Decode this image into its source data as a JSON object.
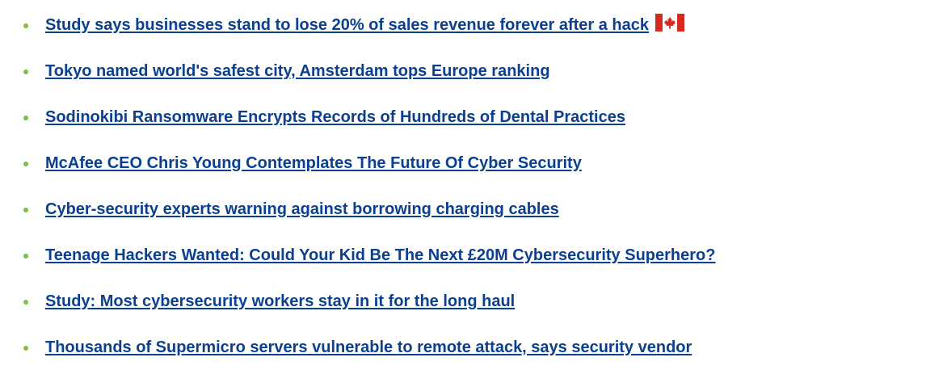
{
  "colors": {
    "link": "#0b3f8f",
    "bullet": "#7bc142",
    "flag_red": "#d52b1e",
    "flag_white": "#ffffff"
  },
  "news": {
    "items": [
      {
        "title": "Study says businesses stand to lose 20% of sales revenue forever after a hack",
        "icon": "canada-flag-icon"
      },
      {
        "title": "Tokyo named world's safest city, Amsterdam tops Europe ranking"
      },
      {
        "title": "Sodinokibi Ransomware Encrypts Records of Hundreds of Dental Practices"
      },
      {
        "title": "McAfee CEO Chris Young Contemplates The Future Of Cyber Security"
      },
      {
        "title": "Cyber-security experts warning against borrowing charging cables"
      },
      {
        "title": "Teenage Hackers Wanted: Could Your Kid Be The Next £20M Cybersecurity Superhero?"
      },
      {
        "title": "Study: Most cybersecurity workers stay in it for the long haul"
      },
      {
        "title": "Thousands of Supermicro servers vulnerable to remote attack, says security vendor"
      }
    ]
  }
}
